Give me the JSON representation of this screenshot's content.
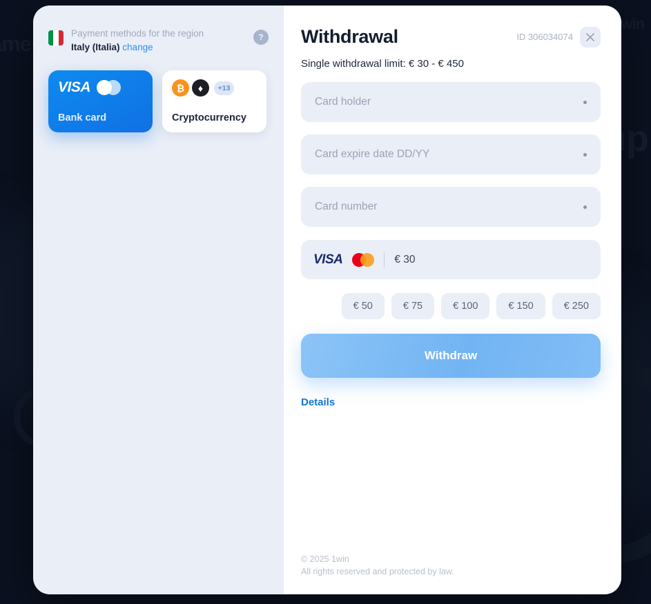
{
  "backdrop": {
    "text_games": "ames",
    "text_up": "up",
    "text_win": "\\win"
  },
  "left_pane": {
    "region": {
      "title": "Payment methods for the region",
      "country": "Italy (Italia)",
      "change_label": "change",
      "flag_icon": "italy-flag-icon",
      "help_icon": "question-mark-icon",
      "help_label": "?"
    },
    "methods": [
      {
        "id": "bank-card",
        "label": "Bank card",
        "selected": true,
        "icons": [
          "visa-logo",
          "mastercard-logo"
        ],
        "visa_label": "VISA"
      },
      {
        "id": "cryptocurrency",
        "label": "Cryptocurrency",
        "selected": false,
        "icons": [
          "bitcoin-icon",
          "ethereum-icon"
        ],
        "bitcoin_glyph": "₿",
        "ethereum_glyph": "♦",
        "more_badge": "+13"
      }
    ]
  },
  "right_pane": {
    "title": "Withdrawal",
    "transaction_id": "ID 306034074",
    "close_icon": "close-icon",
    "limit_text": "Single withdrawal limit: € 30 - € 450",
    "fields": [
      {
        "name": "card-holder",
        "placeholder": "Card holder",
        "value": ""
      },
      {
        "name": "card-expire-date",
        "placeholder": "Card expire date DD/YY",
        "value": ""
      },
      {
        "name": "card-number",
        "placeholder": "Card number",
        "value": ""
      }
    ],
    "amount": {
      "visa_label": "VISA",
      "value": "€ 30",
      "chips": [
        "€ 50",
        "€ 75",
        "€ 100",
        "€ 150",
        "€ 250"
      ]
    },
    "submit_label": "Withdraw",
    "details_label": "Details",
    "footer": {
      "copyright": "© 2025 1win",
      "rights": "All rights reserved and protected by law."
    }
  },
  "colors": {
    "accent_blue": "#1474d4",
    "card_blue": "#0e8bef",
    "panel_bg": "#eaeef7",
    "backdrop": "#0b1120",
    "btc_orange": "#f7931a"
  }
}
